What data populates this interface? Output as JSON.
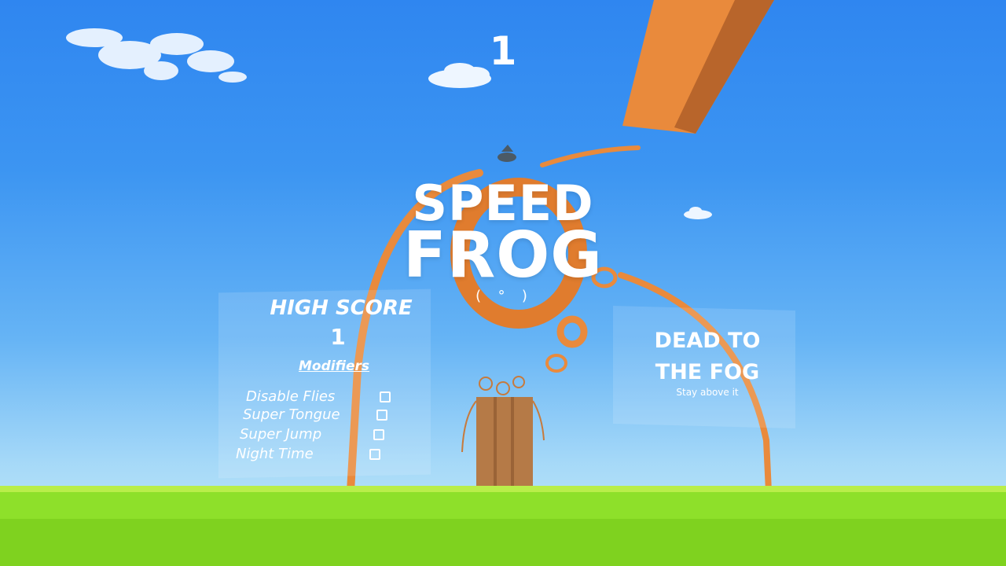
{
  "hud": {
    "score": "1"
  },
  "title": {
    "line1": "SPEED",
    "line2": "FROG",
    "emote": "( ° )"
  },
  "left_panel": {
    "high_score_label": "HIGH SCORE",
    "high_score_value": "1",
    "modifiers_heading": "Modifiers",
    "modifiers": [
      {
        "label": "Disable Flies",
        "checked": false
      },
      {
        "label": "Super Tongue",
        "checked": false
      },
      {
        "label": "Super Jump",
        "checked": false
      },
      {
        "label": "Night Time",
        "checked": false
      }
    ]
  },
  "right_panel": {
    "title_line1": "DEAD TO",
    "title_line2": "THE FOG",
    "subtitle": "Stay above it"
  },
  "colors": {
    "sky_top": "#2f86f0",
    "sky_bottom": "#c8ecfa",
    "grass": "#8ee02a",
    "orange": "#e98a3c",
    "wood": "#b57a47"
  },
  "icons": [
    "cloud-icon",
    "frog-icon"
  ]
}
